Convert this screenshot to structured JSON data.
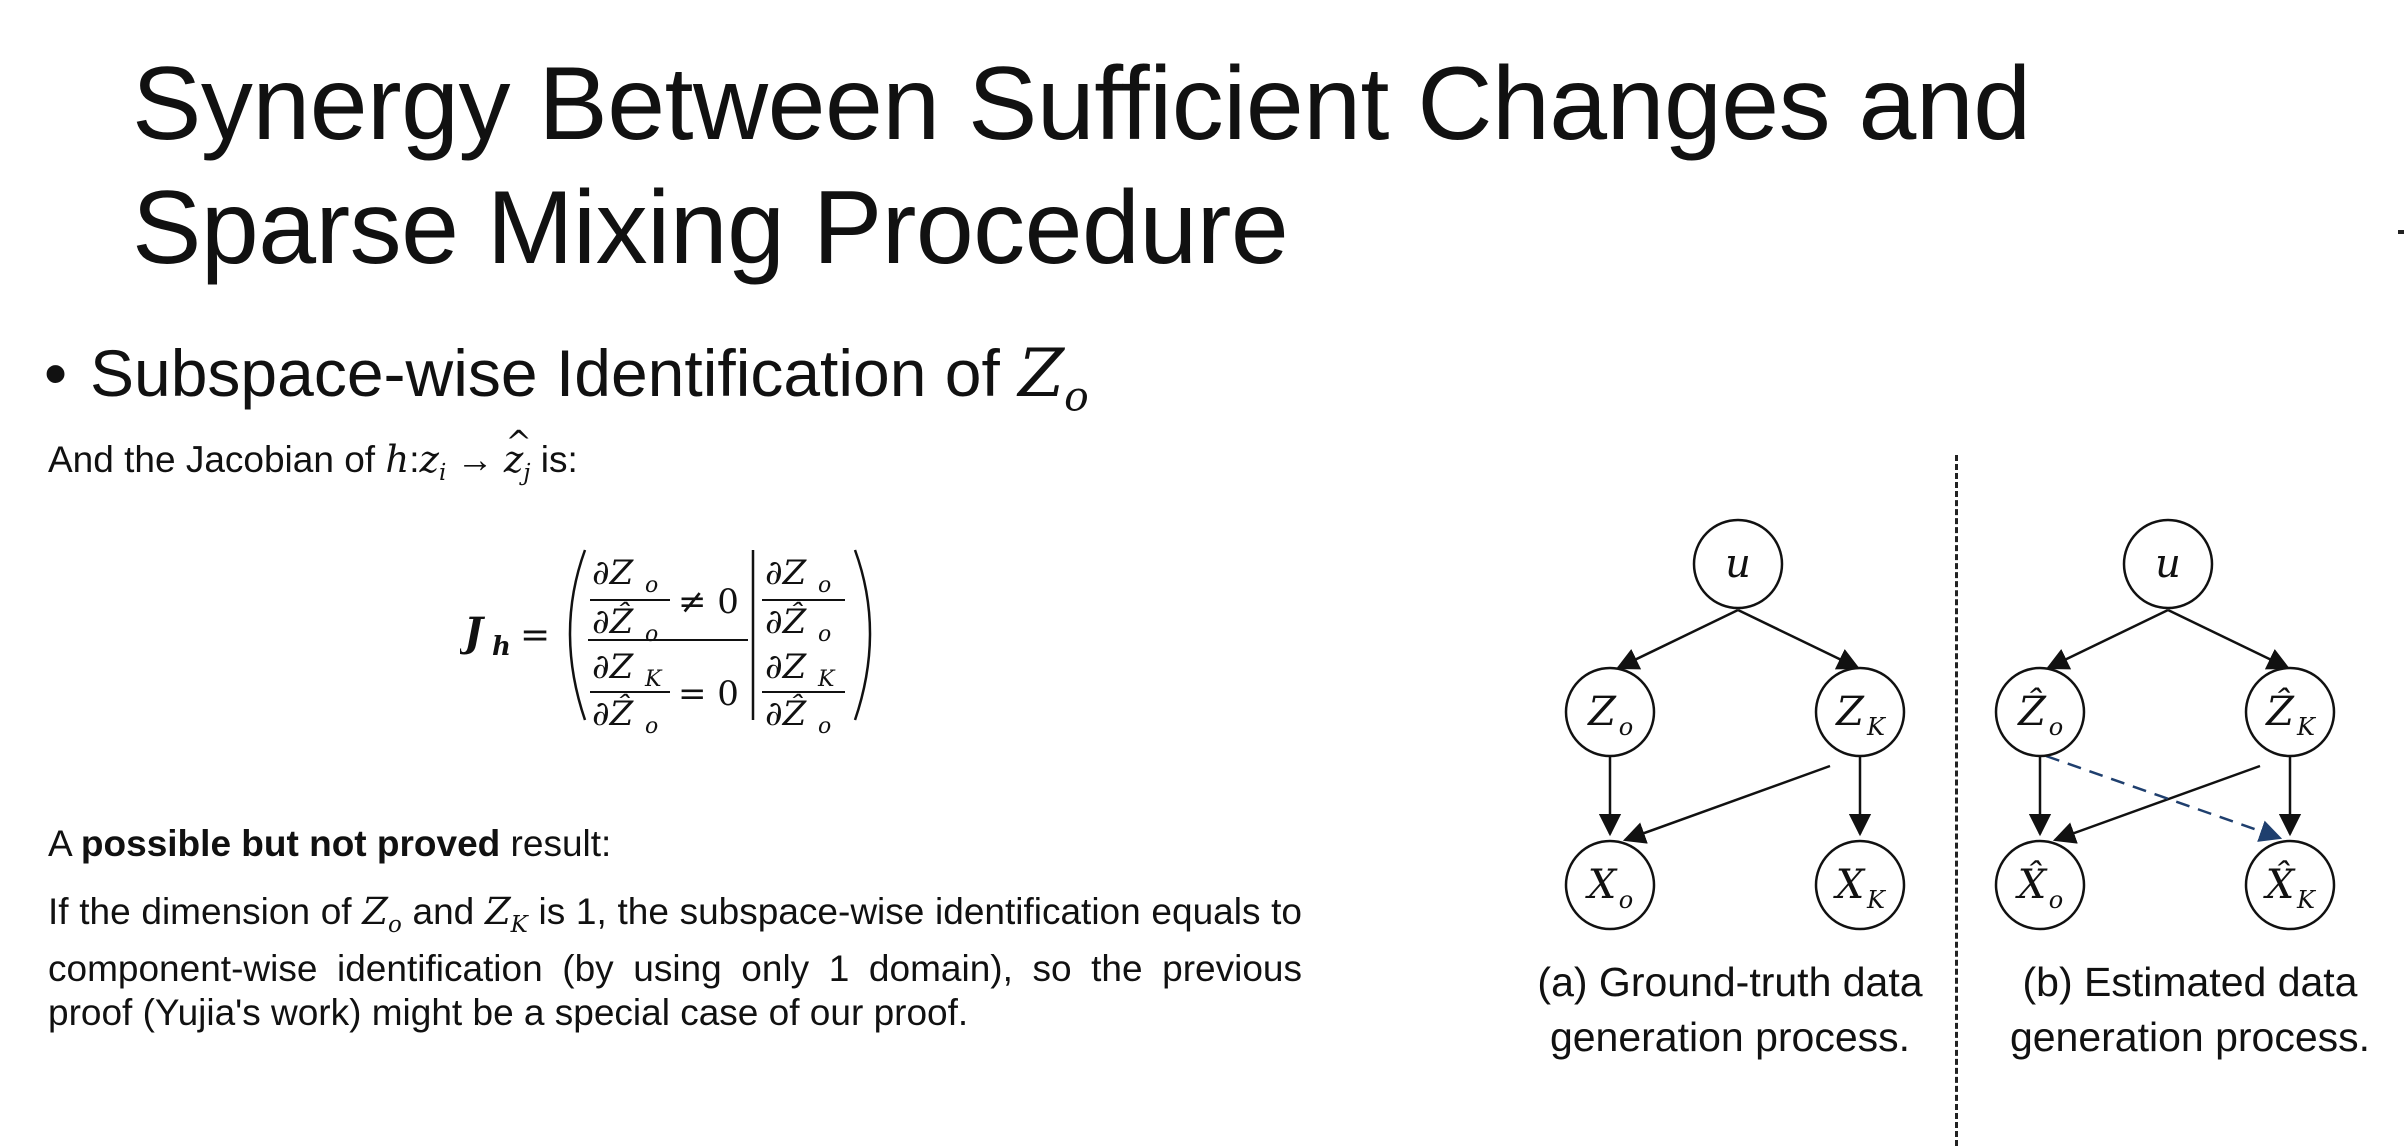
{
  "title": {
    "line1": "Synergy Between Sufficient Changes and",
    "line2": "Sparse Mixing Procedure"
  },
  "bullet": {
    "text": "Subspace-wise Identification of ",
    "symbol": "Z",
    "subscript": "o"
  },
  "intro": {
    "prefix": "And the Jacobian of ",
    "mapping_h": "h",
    "mapping_colon": ":",
    "z_i": "z",
    "i": "i",
    "arrow": " → ",
    "zhat_j": "z",
    "j": "j",
    "suffix": " is:"
  },
  "equation": {
    "lhs": "J",
    "lhs_sub": "h",
    "equals": "=",
    "top_left_num": "∂Z",
    "top_left_den": "∂Ẑ",
    "top_left_rel": "≠ 0",
    "bottom_left_num": "∂Z",
    "bottom_left_den": "∂Ẑ",
    "bottom_left_rel": "= 0",
    "top_right_num": "∂Z",
    "top_right_den": "∂Ẑ",
    "bottom_right_num": "∂Z",
    "bottom_right_den": "∂Ẑ",
    "sub_o": "o",
    "sub_K": "K"
  },
  "possible_result": {
    "prefix": "A ",
    "bold": "possible but not proved",
    "suffix": " result:"
  },
  "paragraph": {
    "part1": "If the dimension of ",
    "Zo": "Z",
    "o": "o",
    "and": " and ",
    "ZK": "Z",
    "K": "K",
    "part2": " is 1, the subspace-wise identification equals to  component-wise identification (by using only 1 domain), so the previous proof   (Yujia's work)   might be a special case of our proof."
  },
  "diagram": {
    "left": {
      "nodes": {
        "u": "u",
        "Zo": "Z",
        "ZK": "Z",
        "Xo": "X",
        "XK": "X"
      },
      "caption_line1": "(a) Ground-truth data",
      "caption_line2": "generation process."
    },
    "right": {
      "nodes": {
        "u": "u",
        "Zo": "Ẑ",
        "ZK": "Ẑ",
        "Xo": "X̂",
        "XK": "X̂"
      },
      "caption_line1": "(b) Estimated data",
      "caption_line2": "generation process."
    },
    "sub_o": "o",
    "sub_K": "K",
    "dashed_edge_color": "#1f3f6e"
  }
}
